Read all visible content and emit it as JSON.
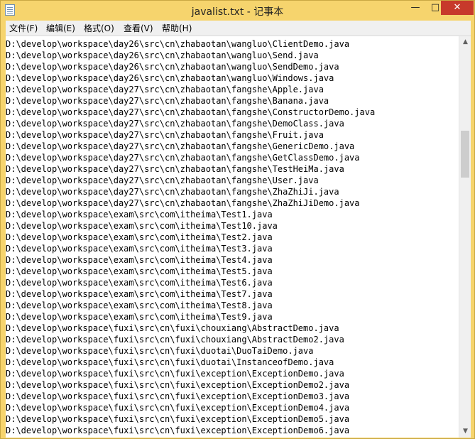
{
  "window": {
    "title": "javalist.txt - 记事本",
    "minimize_glyph": "—",
    "maximize_glyph": "□",
    "close_glyph": "✕",
    "close_color": "#c7392b"
  },
  "menu": [
    {
      "label": "文件(F)"
    },
    {
      "label": "编辑(E)"
    },
    {
      "label": "格式(O)"
    },
    {
      "label": "查看(V)"
    },
    {
      "label": "帮助(H)"
    }
  ],
  "icons": {
    "app": "notepad-icon",
    "scroll_up": "▲",
    "scroll_down": "▼"
  },
  "lines": [
    "D:\\develop\\workspace\\day26\\src\\cn\\zhabaotan\\wangluo\\ClientDemo.java",
    "D:\\develop\\workspace\\day26\\src\\cn\\zhabaotan\\wangluo\\Send.java",
    "D:\\develop\\workspace\\day26\\src\\cn\\zhabaotan\\wangluo\\SendDemo.java",
    "D:\\develop\\workspace\\day26\\src\\cn\\zhabaotan\\wangluo\\Windows.java",
    "D:\\develop\\workspace\\day27\\src\\cn\\zhabaotan\\fangshe\\Apple.java",
    "D:\\develop\\workspace\\day27\\src\\cn\\zhabaotan\\fangshe\\Banana.java",
    "D:\\develop\\workspace\\day27\\src\\cn\\zhabaotan\\fangshe\\ConstructorDemo.java",
    "D:\\develop\\workspace\\day27\\src\\cn\\zhabaotan\\fangshe\\DemoClass.java",
    "D:\\develop\\workspace\\day27\\src\\cn\\zhabaotan\\fangshe\\Fruit.java",
    "D:\\develop\\workspace\\day27\\src\\cn\\zhabaotan\\fangshe\\GenericDemo.java",
    "D:\\develop\\workspace\\day27\\src\\cn\\zhabaotan\\fangshe\\GetClassDemo.java",
    "D:\\develop\\workspace\\day27\\src\\cn\\zhabaotan\\fangshe\\TestHeiMa.java",
    "D:\\develop\\workspace\\day27\\src\\cn\\zhabaotan\\fangshe\\User.java",
    "D:\\develop\\workspace\\day27\\src\\cn\\zhabaotan\\fangshe\\ZhaZhiJi.java",
    "D:\\develop\\workspace\\day27\\src\\cn\\zhabaotan\\fangshe\\ZhaZhiJiDemo.java",
    "D:\\develop\\workspace\\exam\\src\\com\\itheima\\Test1.java",
    "D:\\develop\\workspace\\exam\\src\\com\\itheima\\Test10.java",
    "D:\\develop\\workspace\\exam\\src\\com\\itheima\\Test2.java",
    "D:\\develop\\workspace\\exam\\src\\com\\itheima\\Test3.java",
    "D:\\develop\\workspace\\exam\\src\\com\\itheima\\Test4.java",
    "D:\\develop\\workspace\\exam\\src\\com\\itheima\\Test5.java",
    "D:\\develop\\workspace\\exam\\src\\com\\itheima\\Test6.java",
    "D:\\develop\\workspace\\exam\\src\\com\\itheima\\Test7.java",
    "D:\\develop\\workspace\\exam\\src\\com\\itheima\\Test8.java",
    "D:\\develop\\workspace\\exam\\src\\com\\itheima\\Test9.java",
    "D:\\develop\\workspace\\fuxi\\src\\cn\\fuxi\\chouxiang\\AbstractDemo.java",
    "D:\\develop\\workspace\\fuxi\\src\\cn\\fuxi\\chouxiang\\AbstractDemo2.java",
    "D:\\develop\\workspace\\fuxi\\src\\cn\\fuxi\\duotai\\DuoTaiDemo.java",
    "D:\\develop\\workspace\\fuxi\\src\\cn\\fuxi\\duotai\\InstanceofDemo.java",
    "D:\\develop\\workspace\\fuxi\\src\\cn\\fuxi\\exception\\ExceptionDemo.java",
    "D:\\develop\\workspace\\fuxi\\src\\cn\\fuxi\\exception\\ExceptionDemo2.java",
    "D:\\develop\\workspace\\fuxi\\src\\cn\\fuxi\\exception\\ExceptionDemo3.java",
    "D:\\develop\\workspace\\fuxi\\src\\cn\\fuxi\\exception\\ExceptionDemo4.java",
    "D:\\develop\\workspace\\fuxi\\src\\cn\\fuxi\\exception\\ExceptionDemo5.java",
    "D:\\develop\\workspace\\fuxi\\src\\cn\\fuxi\\exception\\ExceptionDemo6.java"
  ]
}
